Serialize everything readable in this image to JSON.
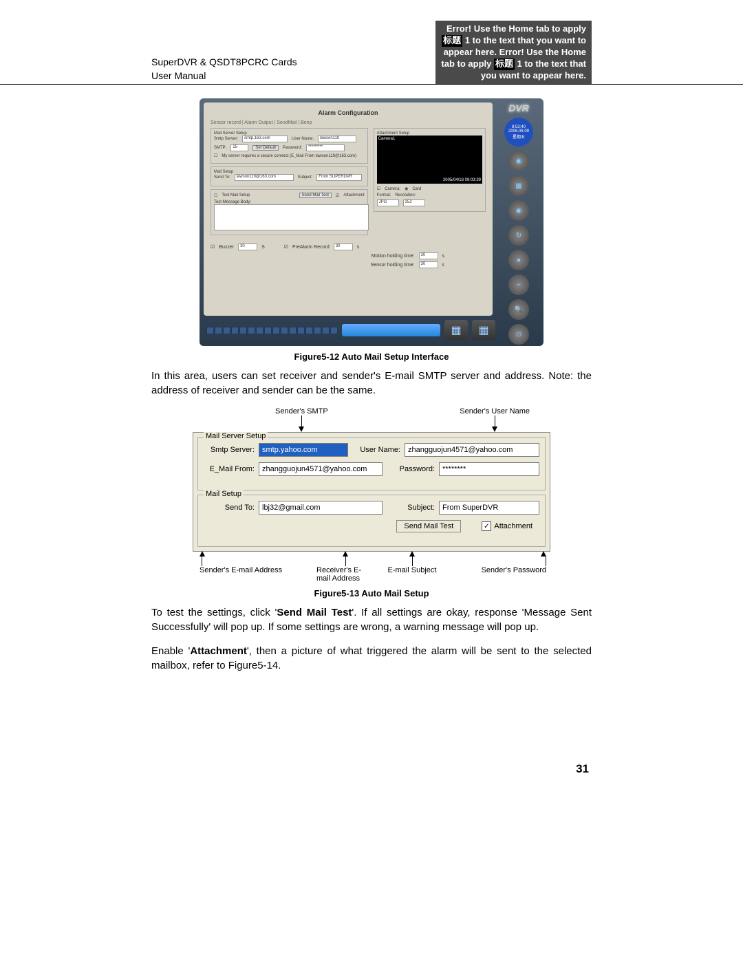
{
  "header": {
    "product": "SuperDVR & QSDT8PCRC Cards",
    "manual": "User Manual",
    "error_line1": "Error! Use the Home tab to apply",
    "error_line2a": "标题",
    "error_line2b": " 1 to the text that you want to",
    "error_line3": "appear here. Error! Use the Home",
    "error_line4a": "tab to apply ",
    "error_line4b": "标题",
    "error_line4c": " 1 to the text that",
    "error_line5": "you want to appear here."
  },
  "fig512": {
    "caption": "Figure5-12 Auto Mail Setup Interface",
    "dvr_logo": "DVR",
    "clock_time": "8:52:40",
    "clock_date": "2006.06.09",
    "clock_day": "星期五",
    "window_title": "Alarm Configuration",
    "tabs": "Sensor record | Alarm Output | SendMail | Beep",
    "mail_server_setup": "Mail Server Setup",
    "smtp_server_label": "Smtp Server:",
    "smtp_server_value": "smtp.163.com",
    "user_name_label": "User Name:",
    "user_name_value": "lawson119",
    "smtp_label": "SMTP:",
    "smtp_value": "25",
    "set_default": "Set Default",
    "password_label": "Password:",
    "password_value": "*********",
    "secure_conn": "My server requires a secure connect (E_Mail From lawson119@163.com)",
    "mail_setup": "Mail Setup",
    "send_to_label": "Send To:",
    "send_to_value": "lawson119@163.com",
    "subject_label": "Subject:",
    "subject_value": "From SUPERDVR",
    "test_mail_setup": "Test Mail Setup",
    "send_mail_test": "Send Mail Test",
    "attachment_chk": "Attachment",
    "test_message_body": "Test Message Body:",
    "attachment_setup": "Attachment Setup",
    "camera_name": "Camera1",
    "timestamp": "2005/04/18 09:03:39",
    "camera_label": "Camera:",
    "camera_value": "Card",
    "format_label": "Format:",
    "resolution_label": "Resolution:",
    "format_value": "JPG",
    "resolution_value": "352",
    "buzzer_label": "Buzzer",
    "buzzer_value": "30",
    "buzzer_unit": "S",
    "precapture_label": "PreAlarm Record",
    "precapture_value": "30",
    "precapture_unit": "s",
    "motion_hold_label": "Motion holding time:",
    "motion_hold_value": "30",
    "motion_hold_unit": "s",
    "sensor_hold_label": "Sensor holding time:",
    "sensor_hold_value": "30",
    "sensor_hold_unit": "s"
  },
  "para1": "In this area, users can set receiver and sender's E-mail SMTP server and address. Note: the address of receiver and sender can be the same.",
  "fig513": {
    "caption": "Figure5-13 Auto Mail Setup",
    "label_smtp": "Sender's SMTP",
    "label_username": "Sender's User Name",
    "group_server": "Mail Server Setup",
    "smtp_server_label": "Smtp Server:",
    "smtp_server_value": "smtp.yahoo.com",
    "user_name_label": "User Name:",
    "user_name_value": "zhangguojun4571@yahoo.com",
    "email_from_label": "E_Mail From:",
    "email_from_value": "zhangguojun4571@yahoo.com",
    "password_label": "Password:",
    "password_value": "********",
    "group_mail": "Mail Setup",
    "send_to_label": "Send To:",
    "send_to_value": "lbj32@gmail.com",
    "subject_label": "Subject:",
    "subject_value": "From SuperDVR",
    "send_mail_test": "Send Mail Test",
    "attachment": "Attachment",
    "label_sender_email": "Sender's E-mail Address",
    "label_receiver_email": "Receiver's E-mail  Address",
    "label_subject": "E-mail Subject",
    "label_password": "Sender's Password"
  },
  "para2a": "To test the settings, click '",
  "para2b": "Send Mail Test",
  "para2c": "'. If all settings are okay, response 'Message Sent Successfully' will pop up. If some settings are wrong, a warning message will pop up.",
  "para3a": "Enable '",
  "para3b": "Attachment",
  "para3c": "', then a picture of what triggered the alarm will be sent to the selected mailbox, refer to Figure5-14.",
  "page_number": "31"
}
